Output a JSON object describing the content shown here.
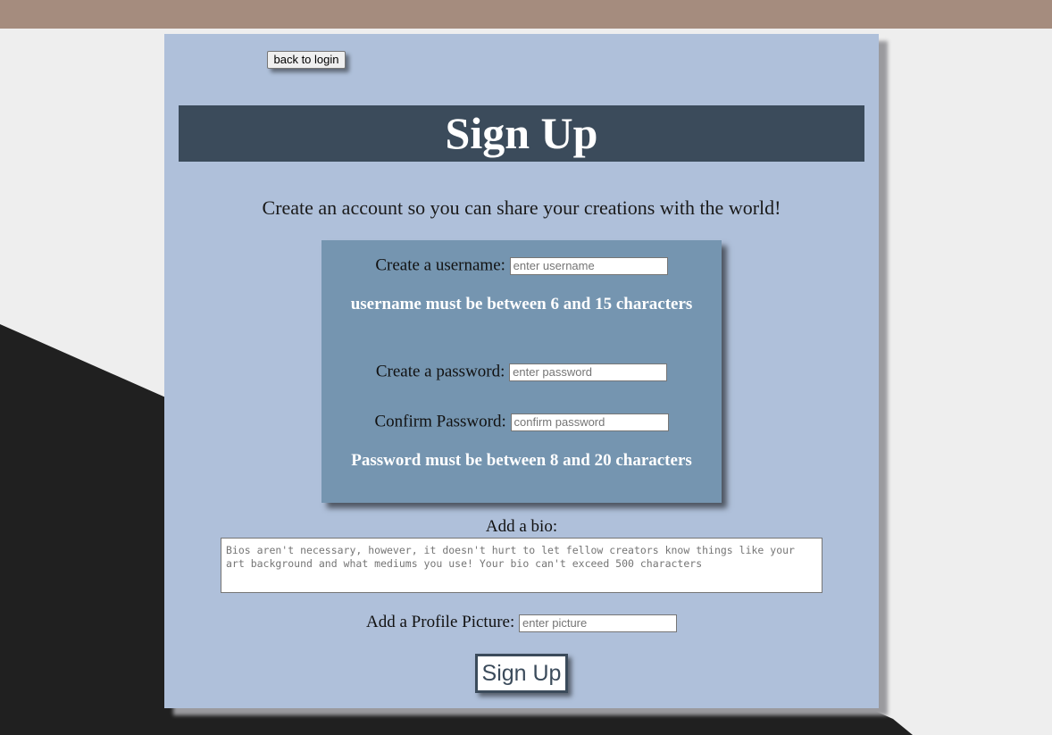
{
  "colors": {
    "top_bar": "#a58c7e",
    "page_background": "#eeeeee",
    "panel_background": "#afc0da",
    "title_bar": "#3b4b5b",
    "inner_box": "#7595b0",
    "hint_text": "#ffffff",
    "dark_shape": "#202020"
  },
  "nav": {
    "back_label": "back to login"
  },
  "header": {
    "title": "Sign Up"
  },
  "intro": {
    "text": "Create an account so you can share your creations with the world!"
  },
  "form": {
    "username": {
      "label": "Create a username:",
      "placeholder": "enter username",
      "hint": "username must be between 6 and 15 characters"
    },
    "password": {
      "label": "Create a password:",
      "placeholder": "enter password"
    },
    "confirm": {
      "label": "Confirm Password:",
      "placeholder": "confirm password",
      "hint": "Password must be between 8 and 20 characters"
    },
    "bio": {
      "label": "Add a bio:",
      "placeholder": "Bios aren't necessary, however, it doesn't hurt to let fellow creators know things like your art background and what mediums you use! Your bio can't exceed 500 characters"
    },
    "picture": {
      "label": "Add a Profile Picture:",
      "placeholder": "enter picture"
    },
    "submit_label": "Sign Up"
  }
}
